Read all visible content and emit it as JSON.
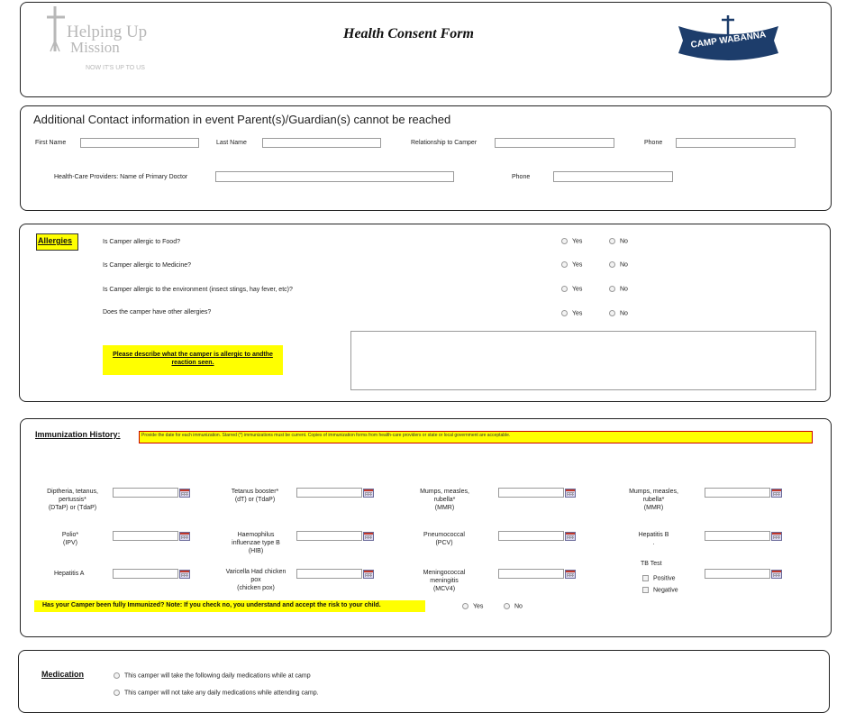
{
  "header": {
    "logo_left_line1": "Helping Up",
    "logo_left_line2": "Mission",
    "logo_left_tagline": "NOW IT'S UP TO US",
    "title": "Health Consent Form",
    "logo_right_text": "CAMP WABANNA"
  },
  "contact": {
    "heading": "Additional Contact information in event Parent(s)/Guardian(s) cannot be reached",
    "first_name": "First Name",
    "last_name": "Last Name",
    "relationship": "Relationship to Camper",
    "phone": "Phone",
    "doctor": "Health-Care Providers: Name of Primary Doctor",
    "doctor_phone": "Phone"
  },
  "allergies": {
    "label": "Allergies",
    "yes": "Yes",
    "no": "No",
    "questions": [
      "Is Camper allergic to Food?",
      "Is Camper allergic to Medicine?",
      "Is Camper allergic to the environment (insect stings, hay fever, etc)?",
      "Does the camper have other allergies?"
    ],
    "describe_line1": "Please describe what the camper is allergic to andthe",
    "describe_line2": "reaction seen."
  },
  "immunization": {
    "label": "Immunization History:",
    "note": "Provide the date for each immunization. Starred (*) immunizations must be current. Copies of immunization forms from health-care providers or state or local government are acceptable.",
    "dtap": [
      "Diptheria, tetanus,",
      "pertussis*",
      "(DTaP) or (TdaP)"
    ],
    "tetanus": [
      "Tetanus booster*",
      "(dT) or (TdaP)"
    ],
    "mmr1": [
      "Mumps, measles,",
      "rubella*",
      "(MMR)"
    ],
    "mmr2": [
      "Mumps, measles,",
      "rubella*",
      "(MMR)"
    ],
    "polio": [
      "Polio*",
      "(IPV)"
    ],
    "hib": [
      "Haemophilus",
      "influenzae type B",
      "(HIB)"
    ],
    "pcv": [
      "Pneumococcal",
      "(PCV)"
    ],
    "hepb": [
      "Hepatitis B",
      "."
    ],
    "hepa": "Hepatitis A",
    "varicella": [
      "Varicella Had chicken",
      "pox",
      "(chicken pox)"
    ],
    "mcv4": [
      "Meningococcal",
      "meningitis",
      "(MCV4)"
    ],
    "tb_title": "TB Test",
    "tb_positive": "Positive",
    "tb_negative": "Negative",
    "fully_immunized": "Has your Camper been fully Immunized? Note: If you check no, you understand and accept the risk to your child.",
    "yes": "Yes",
    "no": "No"
  },
  "medication": {
    "label": "Medication",
    "option1": "This camper will take the following daily medications while at camp",
    "option2": "This camper will not take any daily medications while attending camp."
  }
}
